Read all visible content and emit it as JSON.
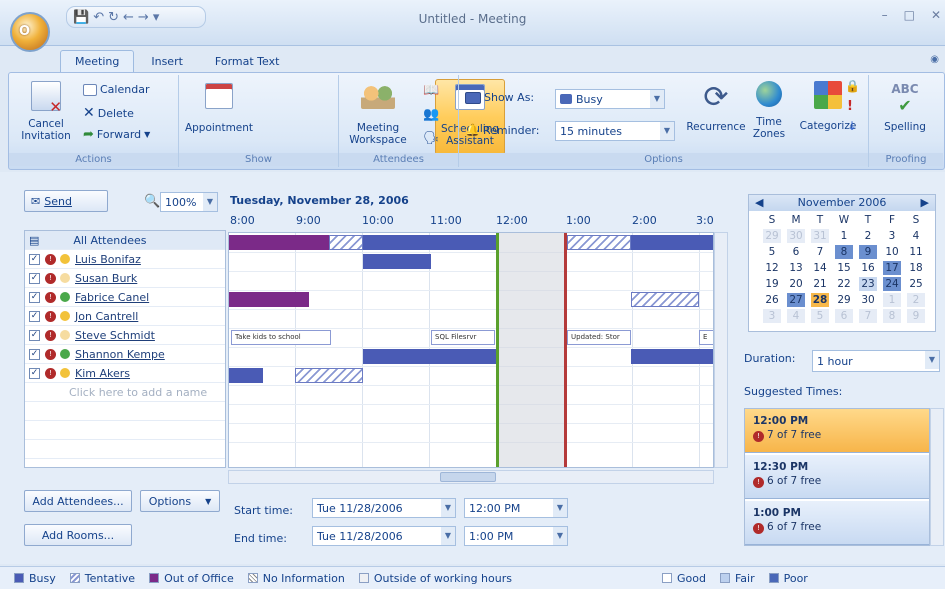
{
  "window": {
    "title": "Untitled - Meeting"
  },
  "office_button": {
    "label": "O"
  },
  "tabs": [
    "Meeting",
    "Insert",
    "Format Text"
  ],
  "ribbon": {
    "actions": {
      "label": "Actions",
      "cancel": "Cancel Invitation",
      "calendar": "Calendar",
      "delete": "Delete",
      "forward": "Forward"
    },
    "show": {
      "label": "Show",
      "appointment": "Appointment",
      "scheduling": "Scheduling Assistant"
    },
    "attendees": {
      "label": "Attendees",
      "workspace": "Meeting Workspace"
    },
    "options": {
      "label": "Options",
      "show_as_label": "Show As:",
      "show_as_value": "Busy",
      "reminder_label": "Reminder:",
      "reminder_value": "15 minutes",
      "recurrence": "Recurrence",
      "time_zones": "Time Zones",
      "categorize": "Categorize"
    },
    "proofing": {
      "label": "Proofing",
      "spelling": "Spelling",
      "abc": "ABC"
    }
  },
  "toolbar": {
    "send": "Send",
    "zoom": "100%"
  },
  "schedule": {
    "date": "Tuesday, November 28, 2006",
    "hours": [
      "8:00",
      "9:00",
      "10:00",
      "11:00",
      "12:00",
      "1:00",
      "2:00",
      "3:0"
    ],
    "appointments": [
      "Take kids to school",
      "SQL Filesrvr",
      "Updated: Stor",
      "E"
    ]
  },
  "attendees": {
    "header": "All Attendees",
    "list": [
      "Luis Bonifaz",
      "Susan Burk",
      "Fabrice Canel",
      "Jon Cantrell",
      "Steve Schmidt",
      "Shannon Kempe",
      "Kim Akers"
    ],
    "add_placeholder": "Click here to add a name"
  },
  "buttons": {
    "add_attendees": "Add Attendees...",
    "options": "Options",
    "add_rooms": "Add Rooms..."
  },
  "times": {
    "start_label": "Start time:",
    "end_label": "End time:",
    "start_date": "Tue 11/28/2006",
    "end_date": "Tue 11/28/2006",
    "start_time": "12:00 PM",
    "end_time": "1:00 PM"
  },
  "calendar": {
    "month": "November 2006",
    "weekdays": [
      "S",
      "M",
      "T",
      "W",
      "T",
      "F",
      "S"
    ],
    "weeks": [
      [
        "29",
        "30",
        "31",
        "1",
        "2",
        "3",
        "4"
      ],
      [
        "5",
        "6",
        "7",
        "8",
        "9",
        "10",
        "11"
      ],
      [
        "12",
        "13",
        "14",
        "15",
        "16",
        "17",
        "18"
      ],
      [
        "19",
        "20",
        "21",
        "22",
        "23",
        "24",
        "25"
      ],
      [
        "26",
        "27",
        "28",
        "29",
        "30",
        "1",
        "2"
      ],
      [
        "3",
        "4",
        "5",
        "6",
        "7",
        "8",
        "9"
      ]
    ]
  },
  "duration": {
    "label": "Duration:",
    "value": "1 hour"
  },
  "suggested": {
    "label": "Suggested Times:",
    "items": [
      {
        "time": "12:00 PM",
        "free": "7 of 7 free"
      },
      {
        "time": "12:30 PM",
        "free": "6 of 7 free"
      },
      {
        "time": "1:00 PM",
        "free": "6 of 7 free"
      }
    ]
  },
  "legend": [
    "Busy",
    "Tentative",
    "Out of Office",
    "No Information",
    "Outside of working hours",
    "Good",
    "Fair",
    "Poor"
  ],
  "colors": {
    "busy": "#4a5bb5",
    "out_of_office": "#7b2a88",
    "good": "#ffffff",
    "fair": "#bcd0ee",
    "poor": "#4a68b8"
  }
}
